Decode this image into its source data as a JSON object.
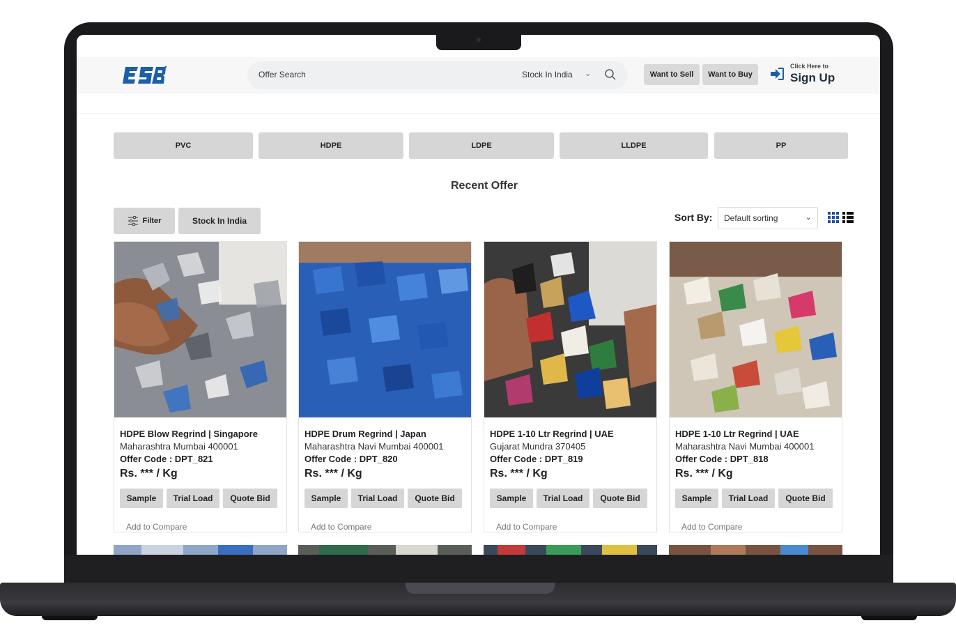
{
  "header": {
    "logo_text": "ESB",
    "search_placeholder": "Offer Search",
    "location": "Stock In India",
    "want_to_sell": "Want to Sell",
    "want_to_buy": "Want to Buy",
    "click_here": "Click Here to",
    "sign_up": "Sign Up"
  },
  "categories": [
    "PVC",
    "HDPE",
    "LDPE",
    "LLDPE",
    "PP"
  ],
  "section_title": "Recent Offer",
  "toolbar": {
    "filter_label": "Filter",
    "stock_label": "Stock In India",
    "sort_by_label": "Sort By:",
    "sort_value": "Default sorting"
  },
  "offers": [
    {
      "title": "HDPE Blow Regrind | Singapore",
      "location": "Maharashtra Mumbai 400001",
      "code": "Offer Code : DPT_821",
      "price": "Rs. *** / Kg",
      "image": "grey-white-blue-plastic-flakes"
    },
    {
      "title": "HDPE Drum Regrind | Japan",
      "location": "Maharashtra Navi Mumbai 400001",
      "code": "Offer Code : DPT_820",
      "price": "Rs. *** / Kg",
      "image": "blue-plastic-regrind"
    },
    {
      "title": "HDPE 1-10 Ltr Regrind | UAE",
      "location": "Gujarat Mundra 370405",
      "code": "Offer Code : DPT_819",
      "price": "Rs. *** / Kg",
      "image": "mixed-colour-plastic-chips"
    },
    {
      "title": "HDPE 1-10 Ltr Regrind | UAE",
      "location": "Maharashtra Navi Mumbai 400001",
      "code": "Offer Code : DPT_818",
      "price": "Rs. *** / Kg",
      "image": "white-mixed-plastic-flakes"
    }
  ],
  "card_actions": {
    "sample": "Sample",
    "trial_load": "Trial Load",
    "quote_bid": "Quote Bid",
    "compare": "Add to Compare"
  },
  "colors": {
    "logo_blue": "#1a5fa8",
    "button_grey": "#d6d6d6",
    "view_icon_blue": "#1f4fa0"
  }
}
